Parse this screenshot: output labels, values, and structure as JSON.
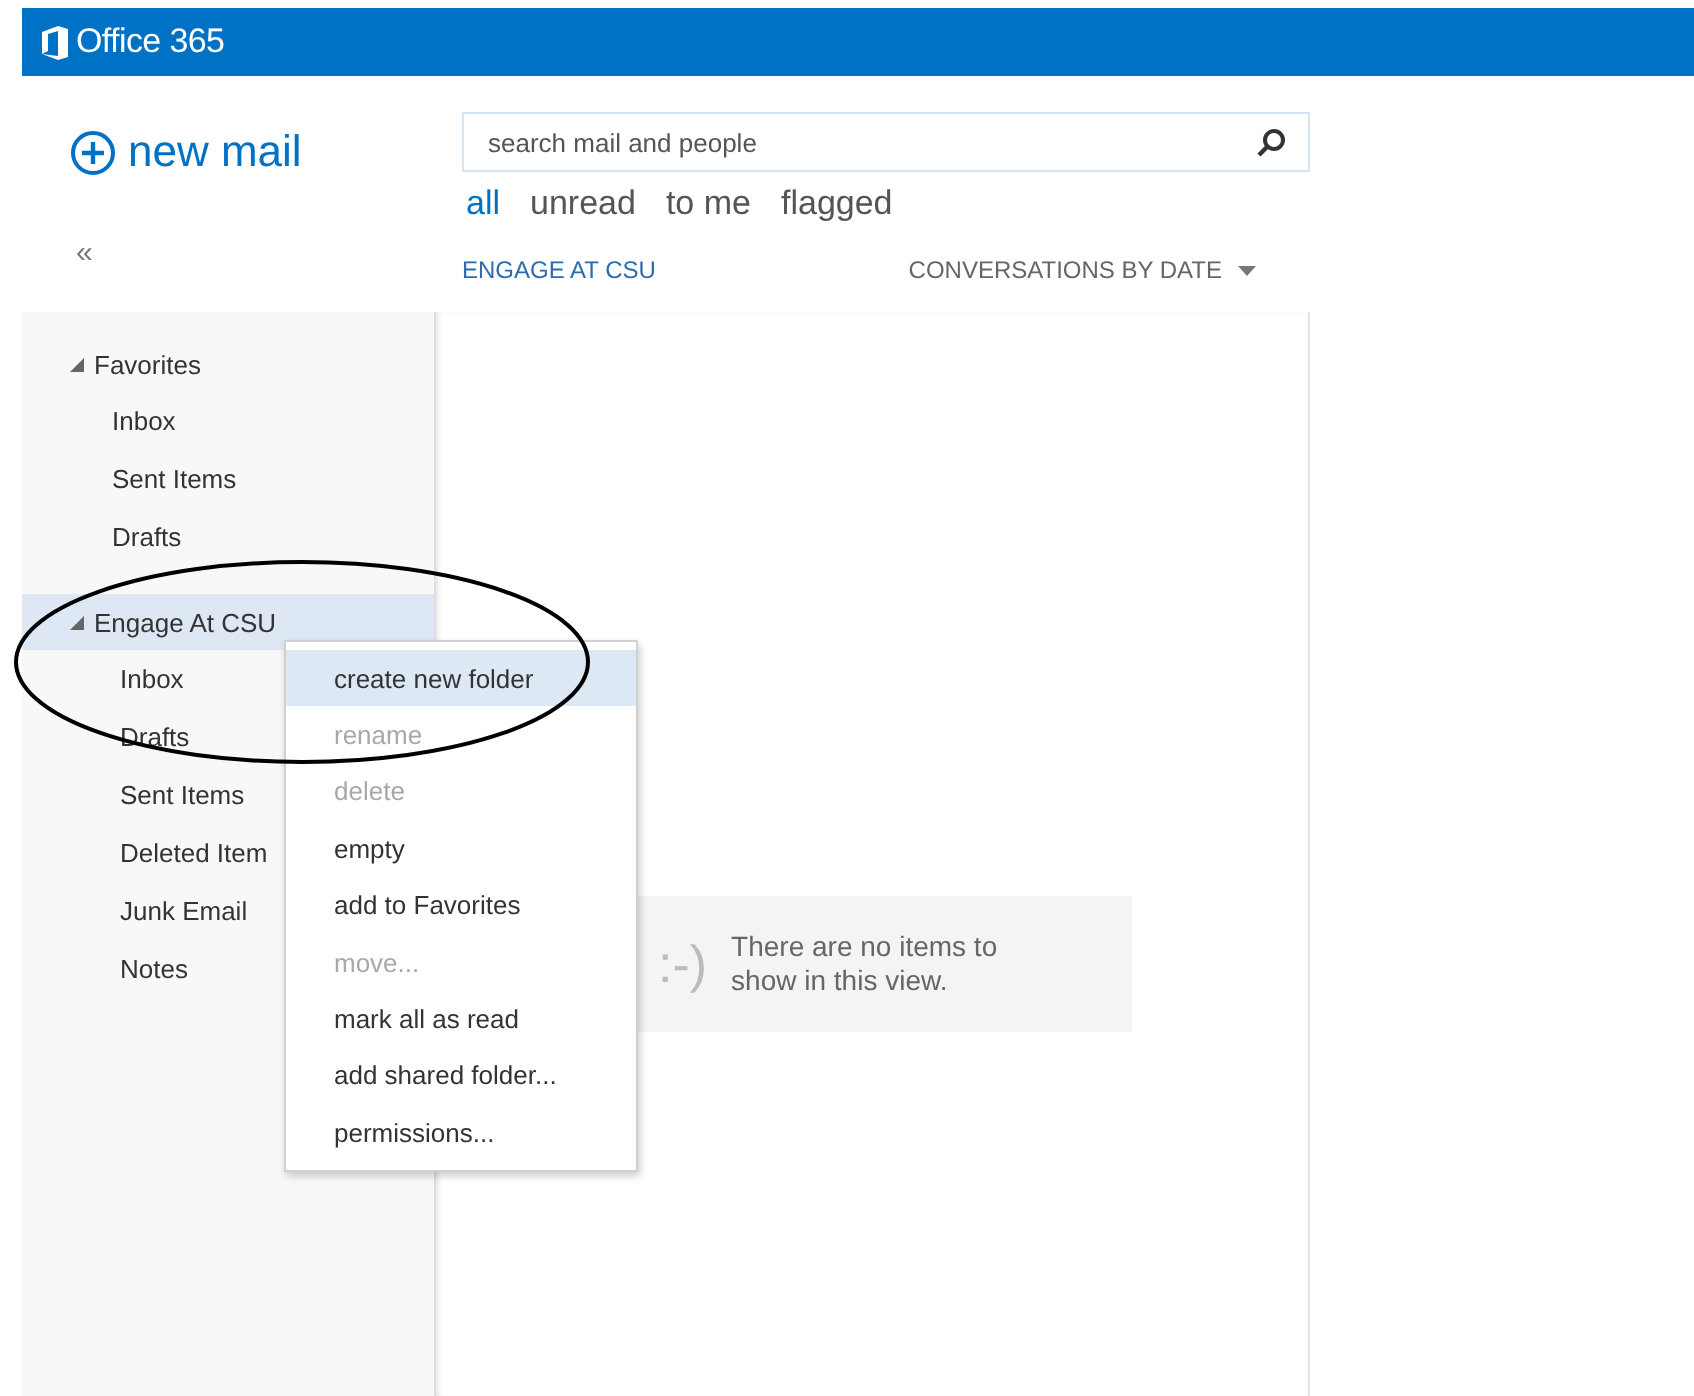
{
  "app": {
    "title": "Office 365"
  },
  "new_mail": {
    "label": "new mail"
  },
  "search": {
    "placeholder": "search mail and people"
  },
  "filters": [
    {
      "label": "all",
      "selected": true
    },
    {
      "label": "unread",
      "selected": false
    },
    {
      "label": "to me",
      "selected": false
    },
    {
      "label": "flagged",
      "selected": false
    }
  ],
  "collapse": {
    "label": "«"
  },
  "folder_header": {
    "title": "ENGAGE AT CSU"
  },
  "sort": {
    "label": "CONVERSATIONS BY DATE"
  },
  "sidebar": {
    "groups": [
      {
        "label": "Favorites",
        "expanded": true,
        "selected": false,
        "children": [
          {
            "label": "Inbox"
          },
          {
            "label": "Sent Items"
          },
          {
            "label": "Drafts"
          }
        ]
      },
      {
        "label": "Engage At CSU",
        "expanded": true,
        "selected": true,
        "children": [
          {
            "label": "Inbox"
          },
          {
            "label": "Drafts"
          },
          {
            "label": "Sent Items"
          },
          {
            "label": "Deleted Item"
          },
          {
            "label": "Junk Email"
          },
          {
            "label": "Notes"
          }
        ]
      }
    ]
  },
  "context_menu": {
    "items": [
      {
        "label": "create new folder",
        "disabled": false,
        "selected": true
      },
      {
        "label": "rename",
        "disabled": true,
        "selected": false
      },
      {
        "label": "delete",
        "disabled": true,
        "selected": false
      },
      {
        "label": "empty",
        "disabled": false,
        "selected": false
      },
      {
        "label": "add to Favorites",
        "disabled": false,
        "selected": false
      },
      {
        "label": "move...",
        "disabled": true,
        "selected": false
      },
      {
        "label": "mark all as read",
        "disabled": false,
        "selected": false
      },
      {
        "label": "add shared folder...",
        "disabled": false,
        "selected": false
      },
      {
        "label": "permissions...",
        "disabled": false,
        "selected": false
      }
    ]
  },
  "empty_state": {
    "emoticon": ":-)",
    "message": "There are no items to show in this view."
  }
}
